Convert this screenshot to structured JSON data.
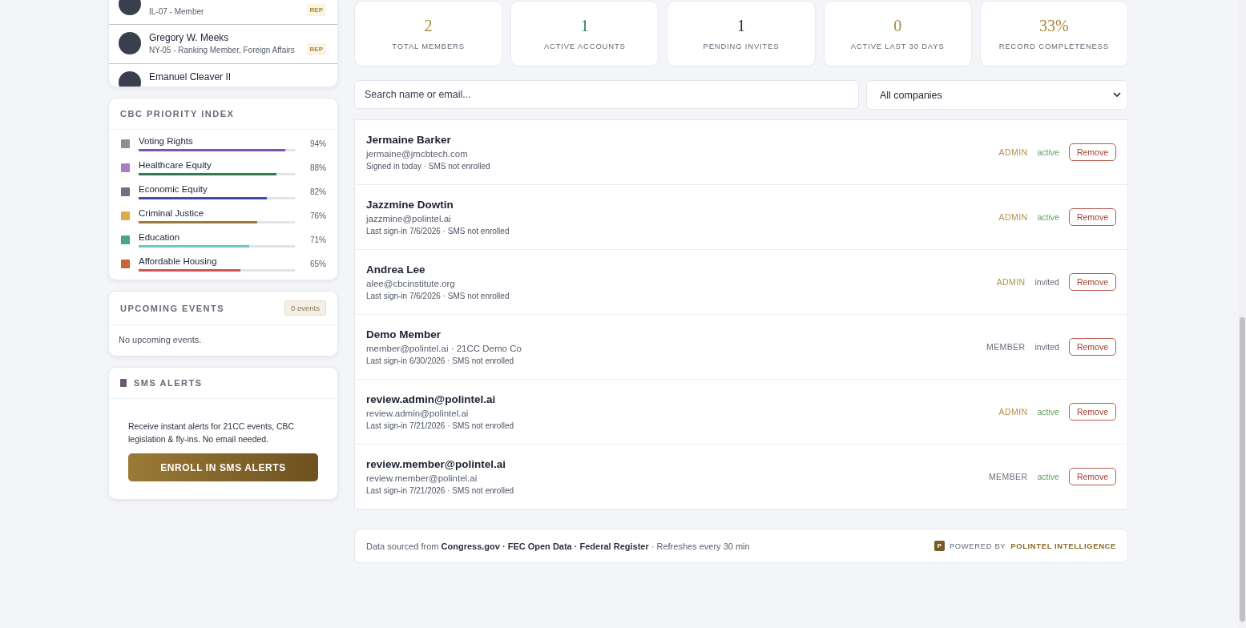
{
  "members_panel": {
    "rows": [
      {
        "name": "",
        "subtitle": "IL-07 - Member",
        "badge": "REP"
      },
      {
        "name": "Gregory W. Meeks",
        "subtitle": "NY-05 - Ranking Member, Foreign Affairs",
        "badge": "REP"
      },
      {
        "name": "Emanuel Cleaver II",
        "subtitle": "",
        "badge": ""
      }
    ]
  },
  "priority_index": {
    "title": "CBC PRIORITY INDEX",
    "items": [
      {
        "label": "Voting Rights",
        "level": 0.94,
        "reading": "94%",
        "color": "#7a55a8"
      },
      {
        "label": "Healthcare Equity",
        "level": 0.88,
        "reading": "88%",
        "color": "#2e7d4f"
      },
      {
        "label": "Economic Equity",
        "level": 0.82,
        "reading": "82%",
        "color": "#3a4fa8"
      },
      {
        "label": "Criminal Justice",
        "level": 0.76,
        "reading": "76%",
        "color": "#9a7b3a"
      },
      {
        "label": "Education",
        "level": 0.71,
        "reading": "71%",
        "color": "#6cc7c4"
      },
      {
        "label": "Affordable Housing",
        "level": 0.65,
        "reading": "65%",
        "color": "#cf5454"
      }
    ]
  },
  "upcoming_events": {
    "title": "UPCOMING EVENTS",
    "count": "0 events",
    "empty_text": "No upcoming events."
  },
  "sms_alerts": {
    "title": "SMS ALERTS",
    "text": "Receive instant alerts for 21CC events, CBC legislation & fly-ins. No email needed.",
    "button": "ENROLL IN SMS ALERTS"
  },
  "stats": [
    {
      "value": "2",
      "label": "TOTAL MEMBERS",
      "color": "#a8893a"
    },
    {
      "value": "1",
      "label": "ACTIVE ACCOUNTS",
      "color": "#2e7d5b"
    },
    {
      "value": "1",
      "label": "PENDING INVITES",
      "color": "#2c3347"
    },
    {
      "value": "0",
      "label": "ACTIVE LAST 30 DAYS",
      "color": "#a8893a"
    },
    {
      "value": "33%",
      "label": "RECORD COMPLETENESS",
      "color": "#a8893a"
    }
  ],
  "search": {
    "placeholder": "Search name or email..."
  },
  "company_filter": {
    "value": "All companies"
  },
  "accounts": [
    {
      "name": "Jermaine Barker",
      "email": "jermaine@jmcbtech.com",
      "detail": "Signed in today · SMS not enrolled",
      "role": {
        "label": "ADMIN",
        "kind": "admin"
      },
      "status": {
        "label": "active",
        "kind": "active"
      },
      "action": "Remove"
    },
    {
      "name": "Jazzmine Dowtin",
      "email": "jazzmine@polintel.ai",
      "detail": "Last sign-in 7/6/2026 · SMS not enrolled",
      "role": {
        "label": "ADMIN",
        "kind": "admin"
      },
      "status": {
        "label": "active",
        "kind": "active"
      },
      "action": "Remove"
    },
    {
      "name": "Andrea Lee",
      "email": "alee@cbcinstitute.org",
      "detail": "Last sign-in 7/6/2026 · SMS not enrolled",
      "role": {
        "label": "ADMIN",
        "kind": "admin"
      },
      "status": {
        "label": "invited",
        "kind": "invited"
      },
      "action": "Remove"
    },
    {
      "name": "Demo Member",
      "email": "member@polintel.ai · 21CC Demo Co",
      "detail": "Last sign-in 6/30/2026 · SMS not enrolled",
      "role": {
        "label": "MEMBER",
        "kind": "member"
      },
      "status": {
        "label": "invited",
        "kind": "invited"
      },
      "action": "Remove"
    },
    {
      "name": "review.admin@polintel.ai",
      "email": "review.admin@polintel.ai",
      "detail": "Last sign-in 7/21/2026 · SMS not enrolled",
      "role": {
        "label": "ADMIN",
        "kind": "admin"
      },
      "status": {
        "label": "active",
        "kind": "active"
      },
      "action": "Remove"
    },
    {
      "name": "review.member@polintel.ai",
      "email": "review.member@polintel.ai",
      "detail": "Last sign-in 7/21/2026 · SMS not enrolled",
      "role": {
        "label": "MEMBER",
        "kind": "member"
      },
      "status": {
        "label": "active",
        "kind": "active"
      },
      "action": "Remove"
    }
  ],
  "footer": {
    "source_text": "Data sourced from **Congress.gov · FEC Open Data · Federal Register** · Refreshes every 30 min",
    "logo_letter": "P",
    "powered_by": "POWERED BY",
    "brand": "POLINTEL INTELLIGENCE"
  }
}
